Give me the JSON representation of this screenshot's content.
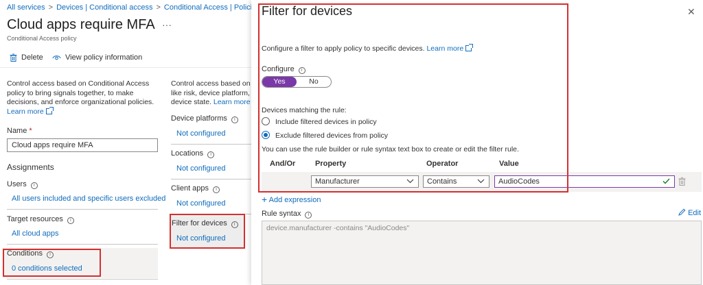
{
  "breadcrumb": {
    "items": [
      "All services",
      "Devices | Conditional access",
      "Conditional Access | Policies"
    ]
  },
  "page": {
    "title": "Cloud apps require MFA",
    "ellipsis": "···",
    "subtitle": "Conditional Access policy"
  },
  "toolbar": {
    "delete_label": "Delete",
    "view_info_label": "View policy information"
  },
  "left": {
    "description": "Control access based on Conditional Access policy to bring signals together, to make decisions, and enforce organizational policies.",
    "learn_more": "Learn more",
    "name_label": "Name",
    "required_mark": "*",
    "name_value": "Cloud apps require MFA",
    "assignments_heading": "Assignments",
    "users_label": "Users",
    "users_value": "All users included and specific users excluded",
    "target_label": "Target resources",
    "target_value": "All cloud apps",
    "conditions_label": "Conditions",
    "conditions_value": "0 conditions selected"
  },
  "middle": {
    "description": "Control access based on signals from conditions like risk, device platform, location, client apps, or device state.",
    "learn_more": "Learn more",
    "items": [
      {
        "label": "Device platforms",
        "value": "Not configured"
      },
      {
        "label": "Locations",
        "value": "Not configured"
      },
      {
        "label": "Client apps",
        "value": "Not configured"
      },
      {
        "label": "Filter for devices",
        "value": "Not configured"
      }
    ]
  },
  "panel": {
    "title": "Filter for devices",
    "close_glyph": "✕",
    "intro": "Configure a filter to apply policy to specific devices.",
    "learn_more": "Learn more",
    "configure_label": "Configure",
    "toggle_yes": "Yes",
    "toggle_no": "No",
    "toggle_selected": "Yes",
    "matching_label": "Devices matching the rule:",
    "radio_include": "Include filtered devices in policy",
    "radio_exclude": "Exclude filtered devices from policy",
    "radio_selected": "exclude",
    "builder_hint": "You can use the rule builder or rule syntax text box to create or edit the filter rule.",
    "table": {
      "headers": [
        "And/Or",
        "Property",
        "Operator",
        "Value"
      ],
      "row": {
        "property": "Manufacturer",
        "operator": "Contains",
        "value": "AudioCodes"
      }
    },
    "add_expression": "Add expression",
    "rule_syntax_label": "Rule syntax",
    "edit_label": "Edit",
    "rule_syntax_value": "device.manufacturer -contains \"AudioCodes\""
  },
  "colors": {
    "link": "#0f6cbd",
    "toggle_on": "#7a39a8",
    "highlight_box": "#d32f2f",
    "selected_row": "#f3f2f1"
  },
  "icons": [
    "chevron-right-icon",
    "ellipsis-icon",
    "trash-icon",
    "eye-icon",
    "external-link-icon",
    "info-icon",
    "close-icon",
    "chevron-down-icon",
    "checkmark-icon",
    "plus-icon",
    "pencil-icon"
  ]
}
